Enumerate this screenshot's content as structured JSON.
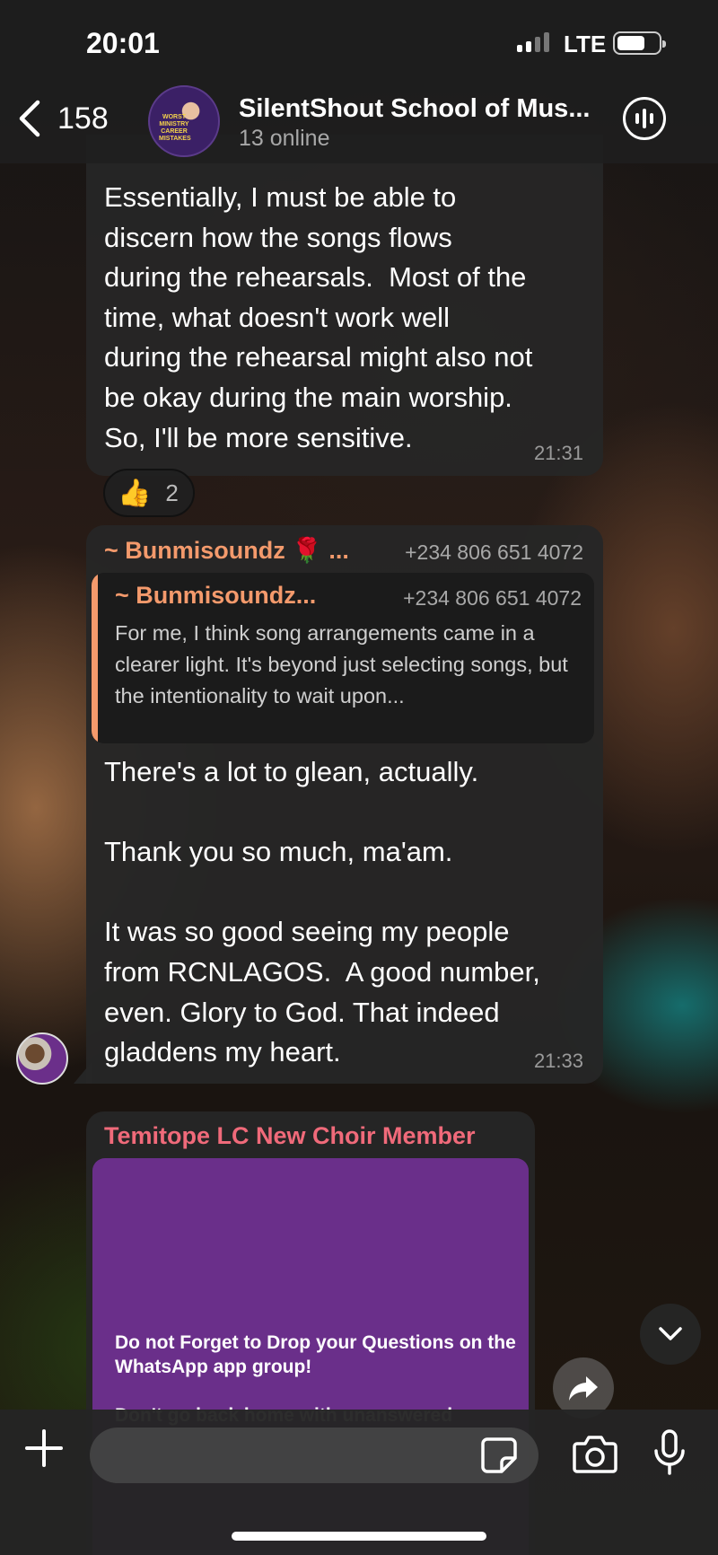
{
  "status_bar": {
    "time": "20:01",
    "network": "LTE"
  },
  "header": {
    "back_count": "158",
    "group_name": "SilentShout School of Mus...",
    "online": "13 online"
  },
  "messages": [
    {
      "text": "Essentially, I must be able to\ndiscern how the songs flows\nduring the rehearsals.  Most of the\ntime, what doesn't work well\nduring the rehearsal might also not\nbe okay during the main worship.\nSo, I'll be more sensitive.",
      "time": "21:31",
      "reaction": {
        "emoji": "👍",
        "count": "2"
      }
    },
    {
      "sender": "~ Bunmisoundz",
      "sender_emoji": "🌹",
      "sender_ellipsis": "...",
      "phone": "+234 806 651 4072",
      "quote": {
        "sender": "~ Bunmisoundz...",
        "phone": "+234 806 651 4072",
        "text": "For me, I think song arrangements came in a clearer light. It's beyond just selecting songs, but the intentionality to wait upon..."
      },
      "text": "There's a lot to glean, actually.\n\nThank you so much, ma'am.\n\nIt was so good seeing my people\nfrom RCNLAGOS.  A good number,\neven. Glory to God. That indeed\ngladdens my heart.",
      "time": "21:33"
    },
    {
      "sender": "Temitope LC New Choir Member",
      "media_text": "Do not Forget to Drop your Questions on the WhatsApp app group!\n\nDon't go back home with unanswered"
    }
  ],
  "group_avatar_text": "WORST MINISTRY CAREER MISTAKES",
  "icons": {
    "back": "chevron-left-icon",
    "voice_chat": "voice-chat-icon",
    "scroll_down": "chevron-down-icon",
    "forward": "forward-icon",
    "attach": "plus-icon",
    "sticker": "sticker-icon",
    "camera": "camera-icon",
    "mic": "microphone-icon"
  },
  "colors": {
    "sender_orange": "#f49a6c",
    "sender_pink": "#f06a7a",
    "media_purple": "#6a2f8a"
  }
}
